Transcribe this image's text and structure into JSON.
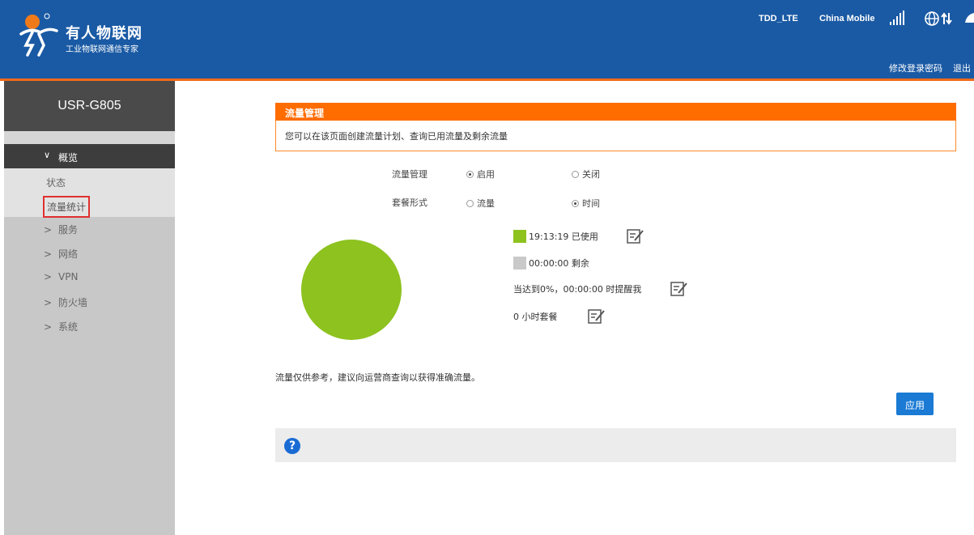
{
  "header": {
    "brand_name": "有人物联网",
    "brand_tagline": "工业物联网通信专家",
    "network_type": "TDD_LTE",
    "carrier": "China Mobile",
    "change_password_label": "修改登录密码",
    "logout_label": "退出",
    "colors": {
      "bar": "#1a5aa4",
      "accent_line": "#f06a1a"
    }
  },
  "sidebar": {
    "device_name": "USR-G805",
    "group": {
      "chevron": "∨",
      "label": "概览"
    },
    "sub_items": [
      {
        "label": "状态"
      },
      {
        "label": "流量统计"
      }
    ],
    "items": [
      {
        "chevron": ">",
        "label": "服务"
      },
      {
        "chevron": ">",
        "label": "网络"
      },
      {
        "chevron": ">",
        "label": "VPN"
      },
      {
        "chevron": ">",
        "label": "防火墙"
      },
      {
        "chevron": ">",
        "label": "系统"
      }
    ]
  },
  "main": {
    "title": "流量管理",
    "description": "您可以在该页面创建流量计划、查询已用流量及剩余流量",
    "traffic_mgmt": {
      "label": "流量管理",
      "options": [
        {
          "label": "启用",
          "selected": true
        },
        {
          "label": "关闭",
          "selected": false
        }
      ]
    },
    "plan_type": {
      "label": "套餐形式",
      "options": [
        {
          "label": "流量",
          "selected": false
        },
        {
          "label": "时间",
          "selected": true
        }
      ]
    },
    "usage": {
      "used_text": "19:13:19 已使用",
      "remaining_text": "00:00:00 剩余",
      "reminder_text": "当达到0%，00:00:00 时提醒我",
      "plan_text": "0 小时套餐",
      "used_color": "#8dc21f",
      "remaining_color": "#c9c9c9"
    },
    "note": "流量仅供参考，建议向运营商查询以获得准确流量。",
    "apply_label": "应用",
    "help_icon_glyph": "?"
  },
  "chart_data": {
    "type": "pie",
    "categories": [
      "已使用",
      "剩余"
    ],
    "values": [
      1,
      0
    ],
    "colors": [
      "#8dc21f",
      "#c9c9c9"
    ]
  }
}
